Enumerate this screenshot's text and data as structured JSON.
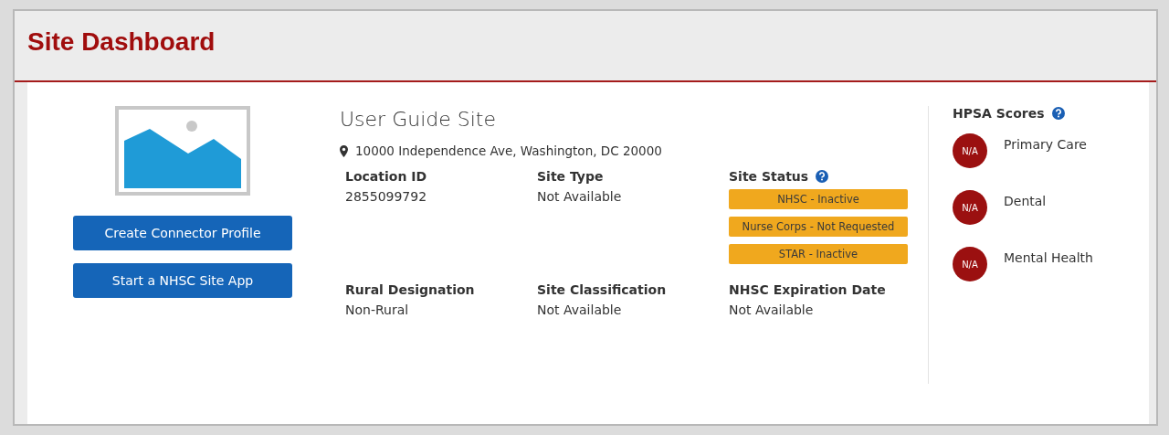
{
  "page": {
    "title": "Site Dashboard"
  },
  "actions": [
    "Create Connector Profile",
    "Start a NHSC Site App"
  ],
  "site": {
    "name": "User Guide Site",
    "address": "10000 Independence Ave, Washington, DC 20000"
  },
  "details": [
    {
      "kind": "text",
      "label": "Location ID",
      "value": "2855099792"
    },
    {
      "kind": "text",
      "label": "Site Type",
      "value": "Not Available"
    },
    {
      "kind": "status",
      "label": "Site Status",
      "badges": [
        "NHSC - Inactive",
        "Nurse Corps - Not Requested",
        "STAR - Inactive"
      ]
    },
    {
      "kind": "text",
      "label": "Rural Designation",
      "value": "Non-Rural"
    },
    {
      "kind": "text",
      "label": "Site Classification",
      "value": "Not Available"
    },
    {
      "kind": "text",
      "label": "NHSC Expiration Date",
      "value": "Not Available"
    }
  ],
  "hpsa": {
    "title": "HPSA Scores",
    "scores": [
      {
        "score": "N/A",
        "label": "Primary Care"
      },
      {
        "score": "N/A",
        "label": "Dental"
      },
      {
        "score": "N/A",
        "label": "Mental Health"
      }
    ]
  }
}
